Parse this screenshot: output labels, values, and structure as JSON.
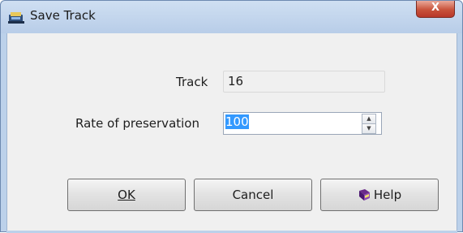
{
  "window": {
    "title": "Save Track",
    "close_label": "X"
  },
  "form": {
    "track_label": "Track",
    "track_value": "16",
    "rate_label": "Rate of preservation",
    "rate_value": "100"
  },
  "buttons": {
    "ok_label": "OK",
    "cancel_label": "Cancel",
    "help_label": "Help"
  },
  "icons": {
    "app": "save-track-icon",
    "help": "help-book-icon",
    "spin_up": "spin-up-arrow-icon",
    "spin_down": "spin-down-arrow-icon"
  },
  "colors": {
    "title_bar": "#bcd1ea",
    "selection": "#3399ff",
    "close_button": "#c8523b"
  }
}
